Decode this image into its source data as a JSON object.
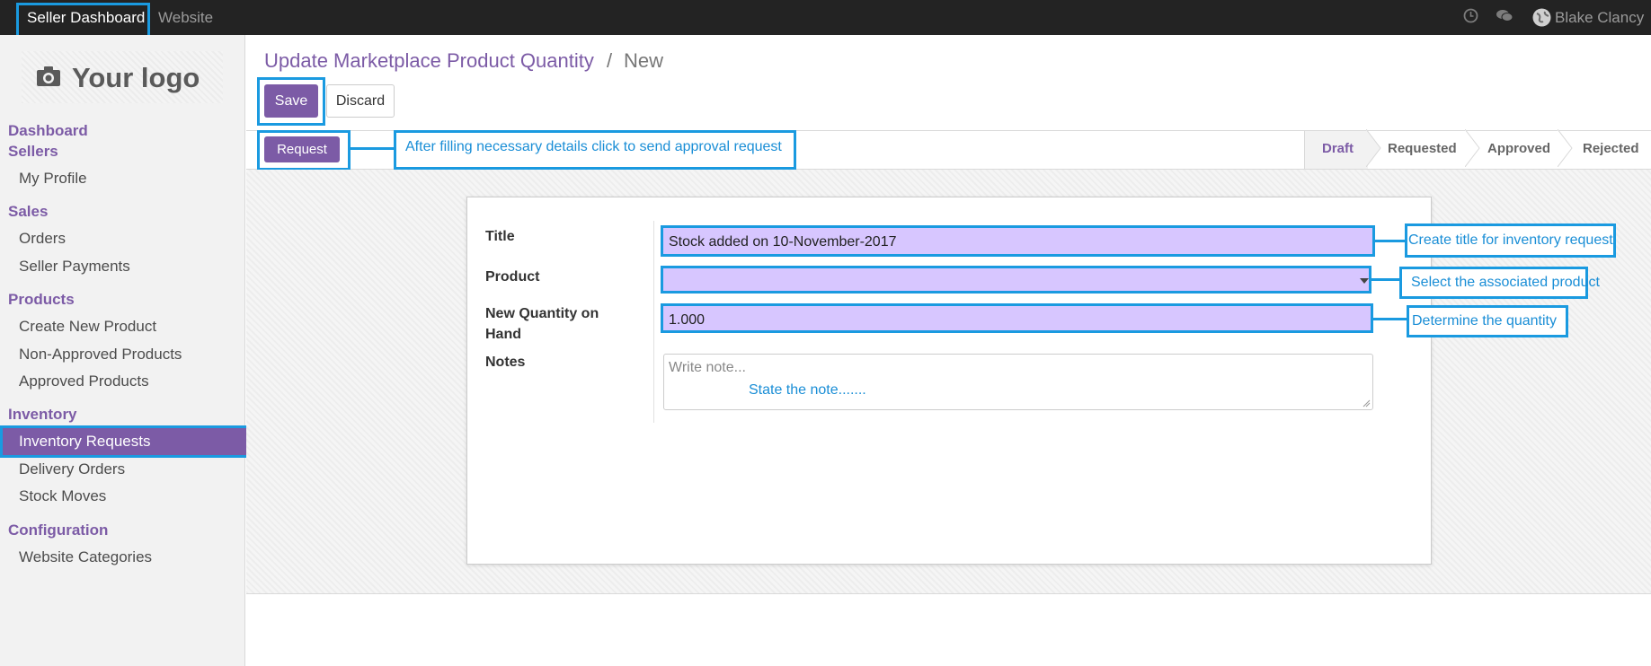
{
  "topbar": {
    "nav": [
      "Seller Dashboard",
      "Website"
    ],
    "user": "Blake Clancy",
    "icons": [
      "clock-icon",
      "chat-icon",
      "globe-avatar-icon"
    ]
  },
  "sidebar": {
    "logo": "Your logo",
    "sections": [
      {
        "title": "Dashboard",
        "items": []
      },
      {
        "title": "Sellers",
        "items": [
          "My Profile"
        ]
      },
      {
        "title": "Sales",
        "items": [
          "Orders",
          "Seller Payments"
        ]
      },
      {
        "title": "Products",
        "items": [
          "Create New Product",
          "Non-Approved Products",
          "Approved Products"
        ]
      },
      {
        "title": "Inventory",
        "items": [
          "Inventory Requests",
          "Delivery Orders",
          "Stock Moves"
        ]
      },
      {
        "title": "Configuration",
        "items": [
          "Website Categories"
        ]
      }
    ],
    "active_item": "Inventory Requests"
  },
  "breadcrumb": {
    "parent": "Update Marketplace Product Quantity",
    "separator": "/",
    "current": "New"
  },
  "buttons": {
    "save": "Save",
    "discard": "Discard",
    "request": "Request"
  },
  "status_stages": [
    "Draft",
    "Requested",
    "Approved",
    "Rejected"
  ],
  "current_stage": "Draft",
  "form": {
    "title_label": "Title",
    "title_value": "Stock added on 10-November-2017",
    "product_label": "Product",
    "product_value": "",
    "qty_label_line1": "New Quantity on",
    "qty_label_line2": "Hand",
    "qty_value": "1.000",
    "notes_label": "Notes",
    "notes_placeholder": "Write note..."
  },
  "annotations": {
    "request": "After filling necessary details click to send approval request",
    "title": "Create title for inventory request",
    "product": "Select the associated product",
    "qty": "Determine the quantity",
    "notes": "State the note......."
  },
  "colors": {
    "brand": "#7c5ba6",
    "highlight": "#1a9ae0",
    "field": "#d7c6ff",
    "topbar": "#232323"
  }
}
